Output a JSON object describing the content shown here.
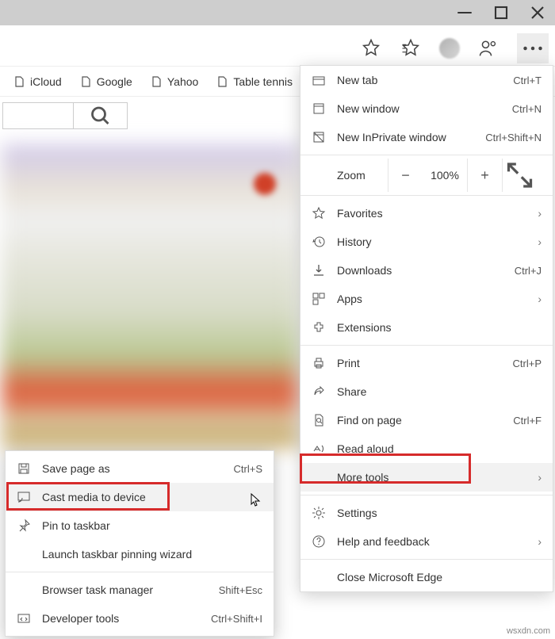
{
  "titlebar": {
    "min": "—",
    "max": "☐",
    "close": "✕"
  },
  "bookmarks": [
    {
      "label": "iCloud"
    },
    {
      "label": "Google"
    },
    {
      "label": "Yahoo"
    },
    {
      "label": "Table tennis"
    }
  ],
  "menu": {
    "newTab": {
      "label": "New tab",
      "shortcut": "Ctrl+T"
    },
    "newWindow": {
      "label": "New window",
      "shortcut": "Ctrl+N"
    },
    "newInPrivate": {
      "label": "New InPrivate window",
      "shortcut": "Ctrl+Shift+N"
    },
    "zoom": {
      "label": "Zoom",
      "value": "100%",
      "minus": "−",
      "plus": "+"
    },
    "favorites": {
      "label": "Favorites"
    },
    "history": {
      "label": "History"
    },
    "downloads": {
      "label": "Downloads",
      "shortcut": "Ctrl+J"
    },
    "apps": {
      "label": "Apps"
    },
    "extensions": {
      "label": "Extensions"
    },
    "print": {
      "label": "Print",
      "shortcut": "Ctrl+P"
    },
    "share": {
      "label": "Share"
    },
    "find": {
      "label": "Find on page",
      "shortcut": "Ctrl+F"
    },
    "readAloud": {
      "label": "Read aloud"
    },
    "moreTools": {
      "label": "More tools"
    },
    "settings": {
      "label": "Settings"
    },
    "help": {
      "label": "Help and feedback"
    },
    "close": {
      "label": "Close Microsoft Edge"
    }
  },
  "submenu": {
    "savePage": {
      "label": "Save page as",
      "shortcut": "Ctrl+S"
    },
    "cast": {
      "label": "Cast media to device"
    },
    "pin": {
      "label": "Pin to taskbar"
    },
    "launch": {
      "label": "Launch taskbar pinning wizard"
    },
    "taskmgr": {
      "label": "Browser task manager",
      "shortcut": "Shift+Esc"
    },
    "devtools": {
      "label": "Developer tools",
      "shortcut": "Ctrl+Shift+I"
    }
  },
  "watermark": "wsxdn.com"
}
